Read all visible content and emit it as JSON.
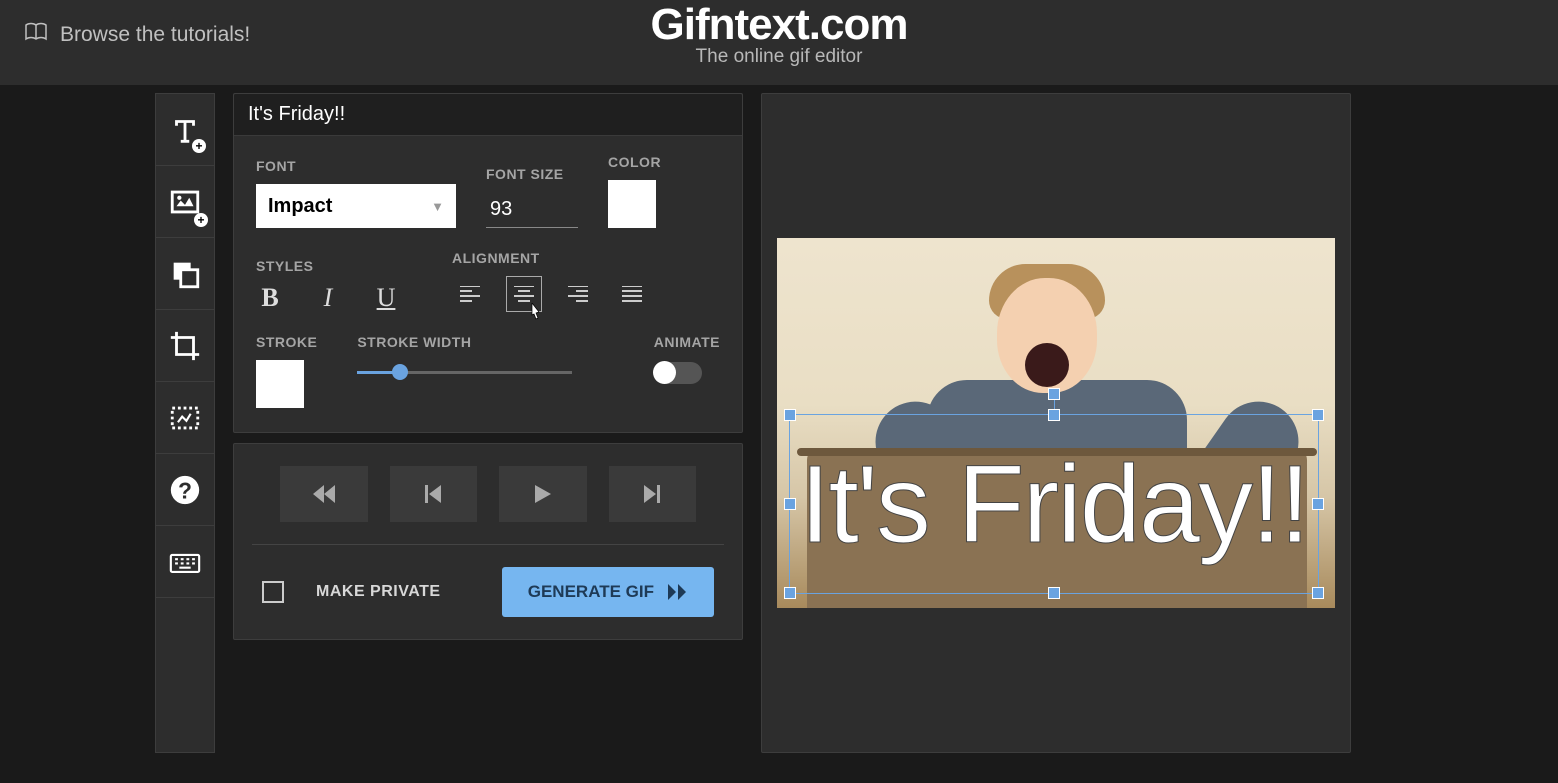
{
  "header": {
    "tutorials_label": "Browse the tutorials!",
    "site_title": "Gifntext.com",
    "site_tagline": "The online gif editor"
  },
  "textbox": {
    "value": "It's Friday!!"
  },
  "font_panel": {
    "font_label": "FONT",
    "font_value": "Impact",
    "size_label": "FONT SIZE",
    "size_value": "93",
    "color_label": "COLOR",
    "color_value": "#ffffff",
    "styles_label": "STYLES",
    "align_label": "ALIGNMENT",
    "active_alignment": "center",
    "stroke_label": "STROKE",
    "stroke_value": "#ffffff",
    "stroke_width_label": "STROKE WIDTH",
    "stroke_width_value": 20,
    "animate_label": "ANIMATE",
    "animate_on": false
  },
  "footer": {
    "make_private_label": "MAKE PRIVATE",
    "make_private_checked": false,
    "generate_label": "GENERATE GIF"
  },
  "canvas": {
    "caption_text": "It's Friday!!"
  },
  "sidebar_icons": [
    "add-text",
    "add-image",
    "layers",
    "crop",
    "canvas-size",
    "help",
    "keyboard"
  ]
}
